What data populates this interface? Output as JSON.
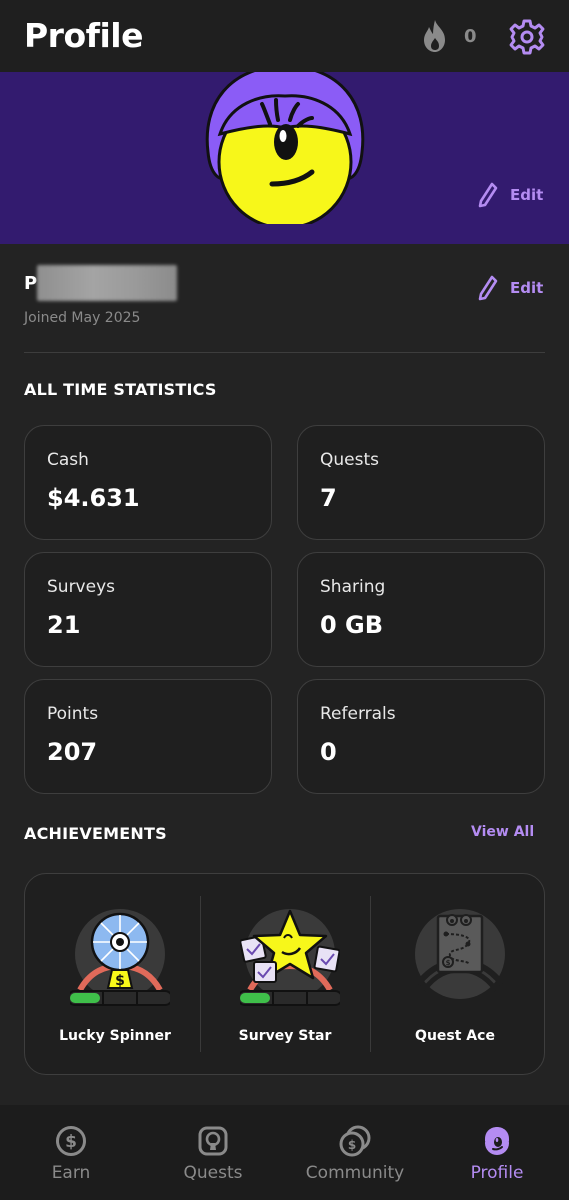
{
  "header": {
    "title": "Profile",
    "streak_count": "0",
    "streak_icon": "flame-icon",
    "settings_icon": "gear-icon"
  },
  "banner": {
    "edit_label": "Edit"
  },
  "profile": {
    "name_initial": "P",
    "joined": "Joined May 2025",
    "edit_label": "Edit"
  },
  "statistics": {
    "title": "ALL TIME STATISTICS",
    "cards": [
      {
        "label": "Cash",
        "value": "$4.631"
      },
      {
        "label": "Quests",
        "value": "7"
      },
      {
        "label": "Surveys",
        "value": "21"
      },
      {
        "label": "Sharing",
        "value": "0 GB"
      },
      {
        "label": "Points",
        "value": "207"
      },
      {
        "label": "Referrals",
        "value": "0"
      }
    ]
  },
  "achievements": {
    "title": "ACHIEVEMENTS",
    "view_all": "View All",
    "items": [
      {
        "name": "Lucky Spinner",
        "progress_segments_filled": 1,
        "progress_segments_total": 3
      },
      {
        "name": "Survey Star",
        "progress_segments_filled": 1,
        "progress_segments_total": 3
      },
      {
        "name": "Quest Ace",
        "locked": true
      }
    ]
  },
  "nav": {
    "items": [
      {
        "label": "Earn",
        "icon": "dollar-coin-icon"
      },
      {
        "label": "Quests",
        "icon": "keyhole-icon"
      },
      {
        "label": "Community",
        "icon": "coins-icon"
      },
      {
        "label": "Profile",
        "icon": "profile-face-icon",
        "active": true
      }
    ]
  },
  "colors": {
    "accent": "#b48cf2",
    "banner": "#331b6f",
    "background": "#232323",
    "card": "#1f1f1f"
  }
}
